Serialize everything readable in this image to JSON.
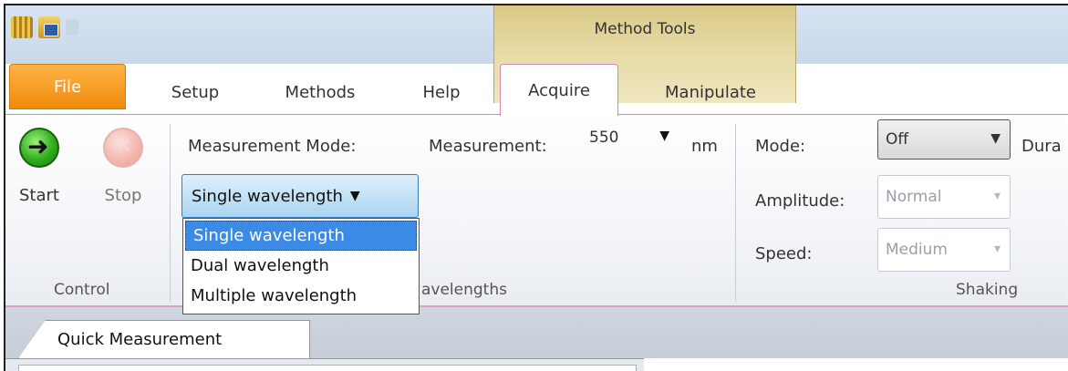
{
  "title_bar": {
    "context_group_title": "Method Tools"
  },
  "tabs": [
    {
      "label": "File"
    },
    {
      "label": "Setup"
    },
    {
      "label": "Methods"
    },
    {
      "label": "Help"
    },
    {
      "label": "Acquire"
    },
    {
      "label": "Manipulate"
    }
  ],
  "control_group": {
    "start_label": "Start",
    "stop_label": "Stop",
    "group_label": "Control"
  },
  "wavelengths_group": {
    "measurement_mode_label": "Measurement Mode:",
    "measurement_label": "Measurement:",
    "measurement_value": "550",
    "unit": "nm",
    "mode_value": "Single wavelength",
    "options": [
      "Single wavelength",
      "Dual wavelength",
      "Multiple wavelength"
    ],
    "group_label_visible": "avelengths"
  },
  "shaking_group": {
    "mode_label": "Mode:",
    "mode_value": "Off",
    "duration_label": "Dura",
    "amplitude_label": "Amplitude:",
    "amplitude_value": "Normal",
    "speed_label": "Speed:",
    "speed_value": "Medium",
    "group_label": "Shaking"
  },
  "document": {
    "tab_label": "Quick Measurement"
  },
  "colors": {
    "file_tab": "#f08a0c",
    "context_group": "#e0d39a",
    "selection": "#3b8ae6",
    "acquire_border": "#d987b0"
  }
}
